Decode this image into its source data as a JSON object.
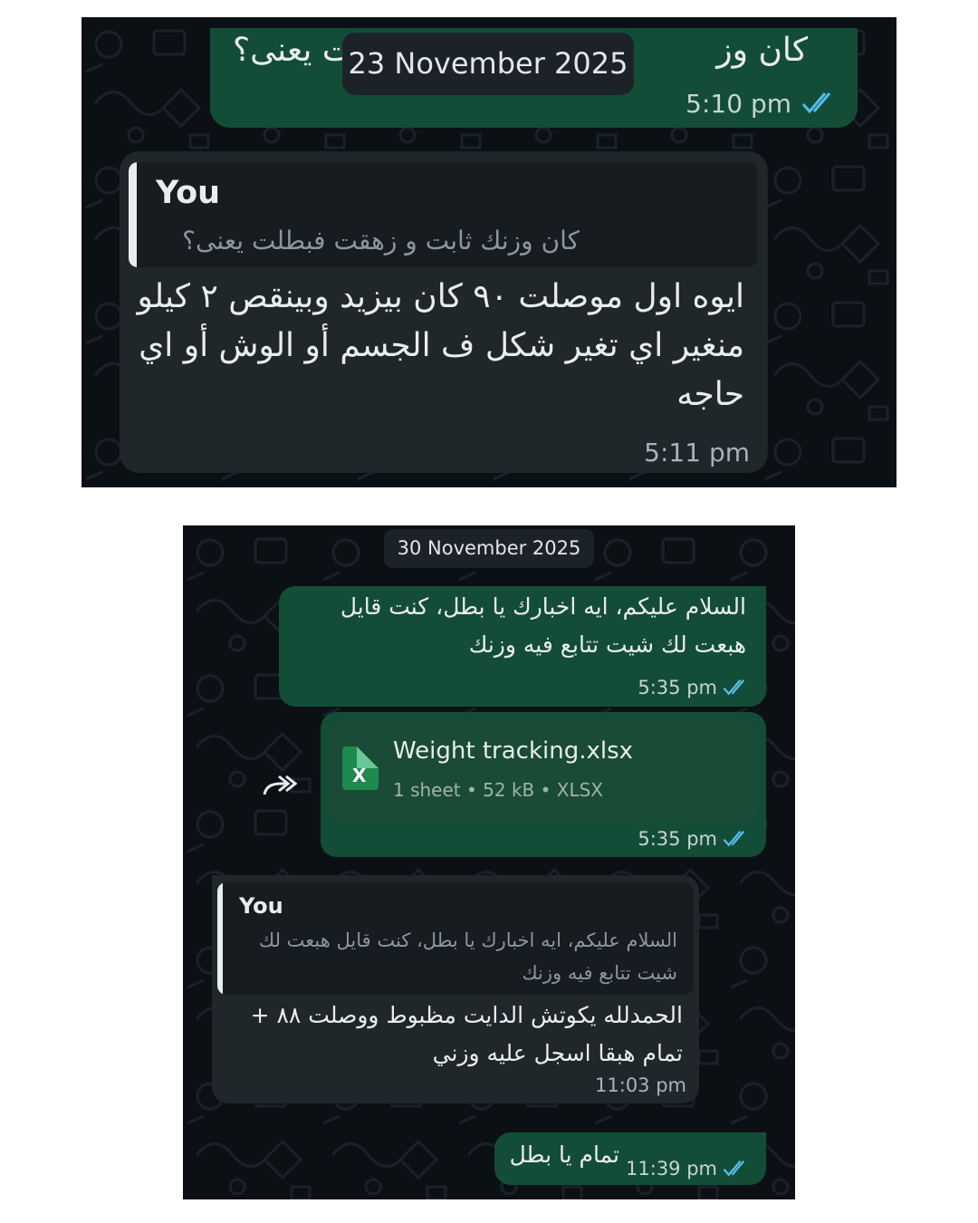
{
  "panel1": {
    "date_badge": "23 November 2025",
    "msg_out": {
      "text_right": "كان وز",
      "text_left": "ت يعنى؟",
      "time": "5:10 pm",
      "status": "read"
    },
    "msg_in": {
      "quote_author": "You",
      "quote_text": "كان وزنك ثابت و زهقت فبطلت يعنى؟",
      "lines": [
        "ايوه اول موصلت ٩٠ كان بيزيد وبينقص ٢ كيلو",
        "منغير اي تغير شكل ف الجسم أو الوش أو اي",
        "حاجه"
      ],
      "time": "5:11 pm"
    }
  },
  "panel2": {
    "date_badge": "30 November 2025",
    "msg_greeting": {
      "lines": [
        "السلام عليكم، ايه اخبارك يا بطل، كنت قايل",
        "هبعت لك شيت تتابع فيه وزنك"
      ],
      "time": "5:35 pm",
      "status": "read"
    },
    "msg_file": {
      "file_name": "Weight tracking.xlsx",
      "file_icon": "excel-file-icon",
      "file_icon_letter": "X",
      "file_meta": "1 sheet • 52 kB • XLSX",
      "forward_icon": "forward-icon",
      "time": "5:35 pm",
      "status": "read"
    },
    "msg_reply": {
      "quote_author": "You",
      "quote_lines": [
        "السلام عليكم، ايه اخبارك يا بطل، كنت قايل هبعت لك",
        "شيت تتابع فيه وزنك"
      ],
      "lines": [
        "الحمدلله يكوتش الدايت مظبوط ووصلت ٨٨ +",
        "تمام هبقا اسجل عليه وزني"
      ],
      "time": "11:03 pm"
    },
    "msg_last": {
      "text": "تمام يا بطل",
      "time": "11:39 pm",
      "status": "read"
    }
  },
  "colors": {
    "chat_bg": "#0b1014",
    "outgoing": "#134d37",
    "incoming": "#1f272b",
    "read_tick": "#53bdeb",
    "excel_green": "#1e8a4f",
    "text": "#e9edef"
  }
}
